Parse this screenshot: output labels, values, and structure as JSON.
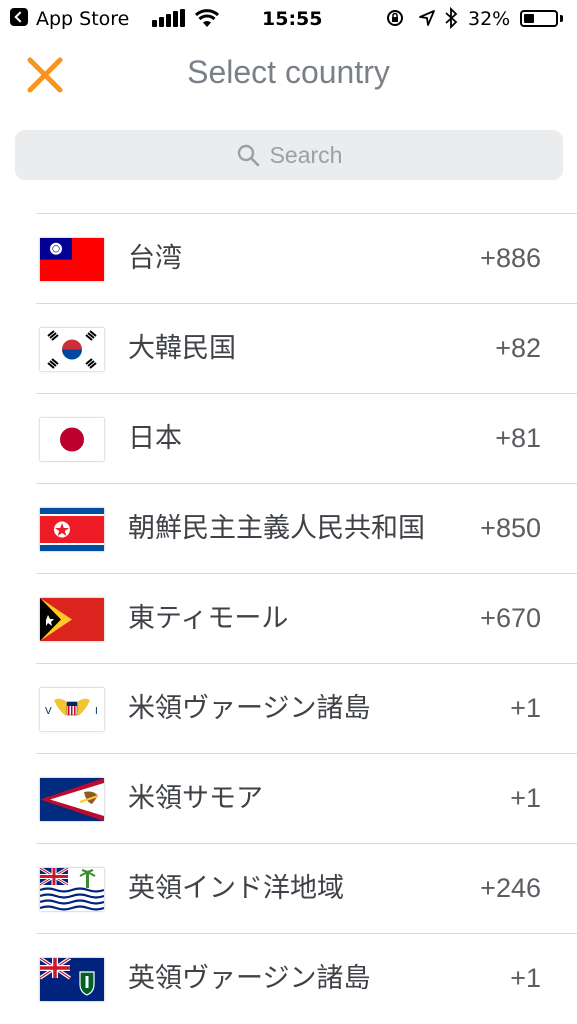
{
  "status_bar": {
    "back_app": "App Store",
    "time": "15:55",
    "battery_percent_label": "32%",
    "battery_level": 0.32
  },
  "header": {
    "title": "Select country",
    "close_icon": "close-icon",
    "accent_color": "#f7941d"
  },
  "search": {
    "placeholder": "Search",
    "icon": "search-icon"
  },
  "countries": [
    {
      "name": "台湾",
      "code": "+886",
      "flag": "taiwan-flag-icon"
    },
    {
      "name": "大韓民国",
      "code": "+82",
      "flag": "south-korea-flag-icon"
    },
    {
      "name": "日本",
      "code": "+81",
      "flag": "japan-flag-icon"
    },
    {
      "name": "朝鮮民主主義人民共和国",
      "code": "+850",
      "flag": "north-korea-flag-icon"
    },
    {
      "name": "東ティモール",
      "code": "+670",
      "flag": "east-timor-flag-icon"
    },
    {
      "name": "米領ヴァージン諸島",
      "code": "+1",
      "flag": "us-virgin-islands-flag-icon"
    },
    {
      "name": "米領サモア",
      "code": "+1",
      "flag": "american-samoa-flag-icon"
    },
    {
      "name": "英領インド洋地域",
      "code": "+246",
      "flag": "british-indian-ocean-territory-flag-icon"
    },
    {
      "name": "英領ヴァージン諸島",
      "code": "+1",
      "flag": "british-virgin-islands-flag-icon"
    }
  ]
}
